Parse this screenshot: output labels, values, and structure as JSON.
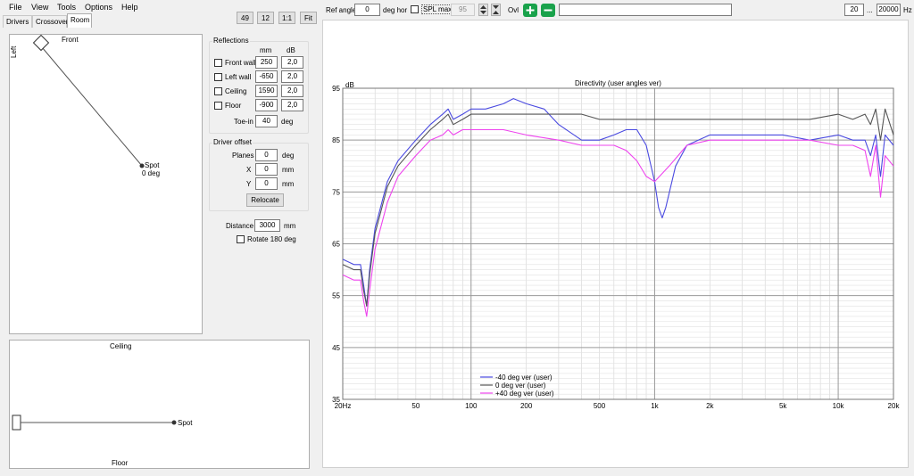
{
  "menu": [
    "File",
    "View",
    "Tools",
    "Options",
    "Help"
  ],
  "tabs": [
    "Drivers",
    "Crossover",
    "Room"
  ],
  "view_buttons": [
    "49",
    "12",
    "1:1",
    "Fit"
  ],
  "top_view": {
    "front_label": "Front",
    "left_label": "Left",
    "spot_label": "Spot",
    "spot_angle": "0 deg"
  },
  "side_view": {
    "ceiling_label": "Ceiling",
    "floor_label": "Floor",
    "spot_label": "Spot"
  },
  "reflections": {
    "title": "Reflections",
    "col_mm": "mm",
    "col_db": "dB",
    "rows": [
      {
        "label": "Front wall",
        "mm": "250",
        "db": "2,0"
      },
      {
        "label": "Left wall",
        "mm": "-650",
        "db": "2,0"
      },
      {
        "label": "Ceiling",
        "mm": "1590",
        "db": "2,0"
      },
      {
        "label": "Floor",
        "mm": "-900",
        "db": "2,0"
      }
    ],
    "toein_label": "Toe-in",
    "toein_value": "40",
    "toein_unit": "deg"
  },
  "driver_offset": {
    "title": "Driver offset",
    "rows": [
      {
        "label": "Planes",
        "value": "0",
        "unit": "deg"
      },
      {
        "label": "X",
        "value": "0",
        "unit": "mm"
      },
      {
        "label": "Y",
        "value": "0",
        "unit": "mm"
      }
    ],
    "relocate_label": "Relocate"
  },
  "distance": {
    "label": "Distance",
    "value": "3000",
    "unit": "mm"
  },
  "rotate_label": "Rotate 180 deg",
  "toolbar": {
    "ref_angle_label": "Ref angle",
    "ref_angle_value": "0",
    "deg_hor": "deg hor",
    "spl_max": "SPL max",
    "spl_value": "95",
    "ovl": "Ovl",
    "freq_min": "20",
    "freq_sep": "...",
    "freq_max": "20000",
    "hz": "Hz"
  },
  "colors": {
    "blue": "#4a4ae0",
    "dark": "#555555",
    "magenta": "#ee44ee"
  },
  "chart_data": {
    "type": "line",
    "title": "Directivity (user angles ver)",
    "ylabel": "dB",
    "xlabel": "",
    "x_scale": "log",
    "xlim": [
      20,
      20000
    ],
    "ylim": [
      35,
      95
    ],
    "x_ticks": [
      {
        "v": 20,
        "label": "20Hz"
      },
      {
        "v": 50,
        "label": "50"
      },
      {
        "v": 100,
        "label": "100"
      },
      {
        "v": 200,
        "label": "200"
      },
      {
        "v": 500,
        "label": "500"
      },
      {
        "v": 1000,
        "label": "1k"
      },
      {
        "v": 2000,
        "label": "2k"
      },
      {
        "v": 5000,
        "label": "5k"
      },
      {
        "v": 10000,
        "label": "10k"
      },
      {
        "v": 20000,
        "label": "20k"
      }
    ],
    "y_ticks": [
      {
        "v": 95,
        "label": "95"
      },
      {
        "v": 85,
        "label": "85"
      },
      {
        "v": 75,
        "label": "75"
      },
      {
        "v": 65,
        "label": "65"
      },
      {
        "v": 55,
        "label": "55"
      },
      {
        "v": 45,
        "label": "45"
      },
      {
        "v": 35,
        "label": "35"
      }
    ],
    "grid": true,
    "legend_position": "bottom-left",
    "series": [
      {
        "name": "-40 deg ver (user)",
        "color": "#4a4ae0",
        "x": [
          20,
          23,
          25,
          26,
          27,
          28,
          30,
          35,
          40,
          50,
          60,
          70,
          75,
          80,
          90,
          100,
          120,
          150,
          170,
          200,
          250,
          300,
          400,
          500,
          600,
          700,
          800,
          900,
          1000,
          1050,
          1100,
          1150,
          1300,
          1500,
          2000,
          3000,
          4000,
          5000,
          7000,
          10000,
          12000,
          14000,
          15000,
          16000,
          17000,
          18000,
          20000
        ],
        "y": [
          62,
          61,
          61,
          57,
          53,
          60,
          68,
          77,
          81,
          85,
          88,
          90,
          91,
          89,
          90,
          91,
          91,
          92,
          93,
          92,
          91,
          88,
          85,
          85,
          86,
          87,
          87,
          84,
          77,
          72,
          70,
          72,
          80,
          84,
          86,
          86,
          86,
          86,
          85,
          86,
          85,
          85,
          82,
          86,
          78,
          86,
          84
        ]
      },
      {
        "name": "0 deg ver (user)",
        "color": "#555555",
        "x": [
          20,
          23,
          25,
          26,
          27,
          28,
          30,
          35,
          40,
          50,
          60,
          70,
          75,
          80,
          90,
          100,
          120,
          150,
          200,
          300,
          400,
          500,
          700,
          1000,
          1500,
          2000,
          3000,
          5000,
          7000,
          10000,
          12000,
          14000,
          15000,
          16000,
          17000,
          18000,
          20000
        ],
        "y": [
          61,
          60,
          60,
          56,
          53,
          59,
          67,
          76,
          80,
          84,
          87,
          89,
          90,
          88,
          89,
          90,
          90,
          90,
          90,
          90,
          90,
          89,
          89,
          89,
          89,
          89,
          89,
          89,
          89,
          90,
          89,
          90,
          88,
          91,
          85,
          91,
          86
        ]
      },
      {
        "name": "+40 deg ver (user)",
        "color": "#ee44ee",
        "x": [
          20,
          23,
          25,
          26,
          27,
          28,
          30,
          35,
          40,
          50,
          60,
          70,
          75,
          80,
          90,
          100,
          150,
          200,
          300,
          400,
          500,
          600,
          700,
          800,
          900,
          1000,
          1200,
          1500,
          2000,
          3000,
          5000,
          7000,
          10000,
          12000,
          14000,
          15000,
          16000,
          17000,
          18000,
          20000
        ],
        "y": [
          59,
          58,
          58,
          54,
          51,
          56,
          64,
          73,
          78,
          82,
          85,
          86,
          87,
          86,
          87,
          87,
          87,
          86,
          85,
          84,
          84,
          84,
          83,
          81,
          78,
          77,
          80,
          84,
          85,
          85,
          85,
          85,
          84,
          84,
          83,
          78,
          84,
          74,
          82,
          80
        ]
      }
    ]
  }
}
